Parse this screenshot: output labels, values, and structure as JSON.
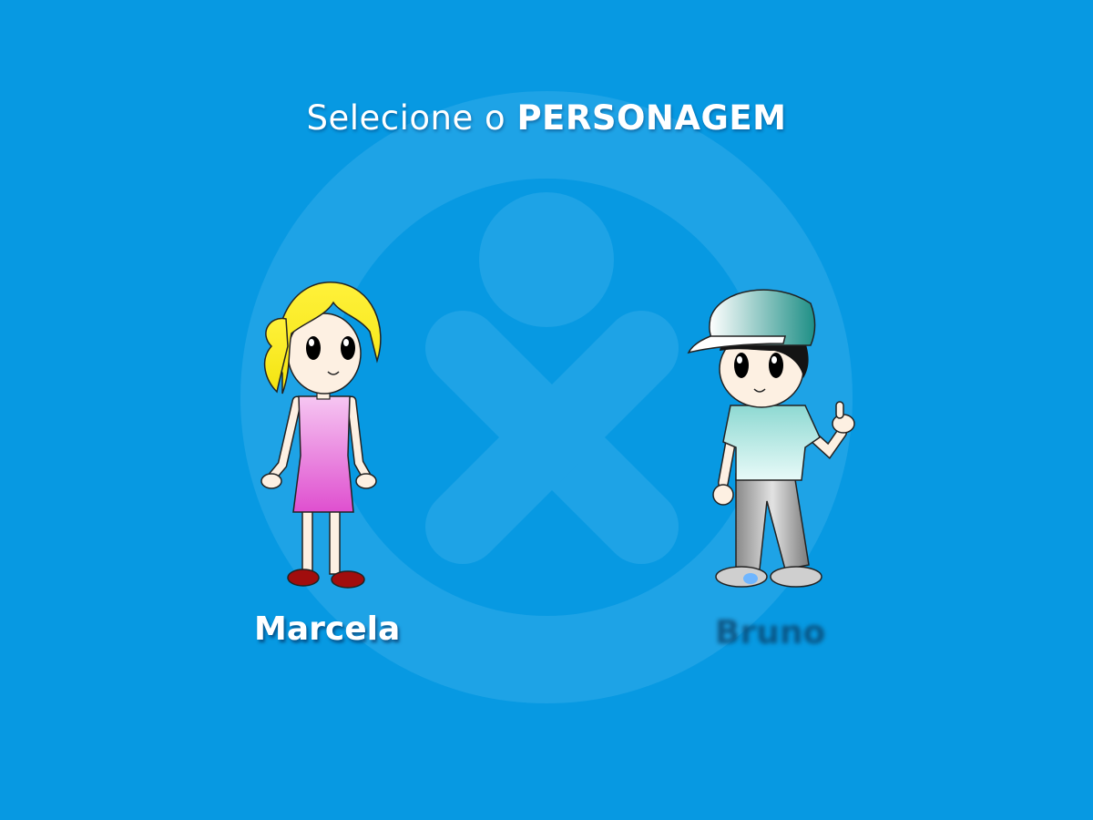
{
  "screen": {
    "title_prefix": "Selecione o",
    "title_emphasis": "PERSONAGEM"
  },
  "characters": [
    {
      "id": "marcela",
      "name": "Marcela",
      "state": "highlighted"
    },
    {
      "id": "bruno",
      "name": "Bruno",
      "state": "dimmed"
    }
  ],
  "colors": {
    "background": "#0799e2",
    "title_text": "#ffffff",
    "selected_name": "#ffffff",
    "unselected_name": "#0a4670"
  }
}
